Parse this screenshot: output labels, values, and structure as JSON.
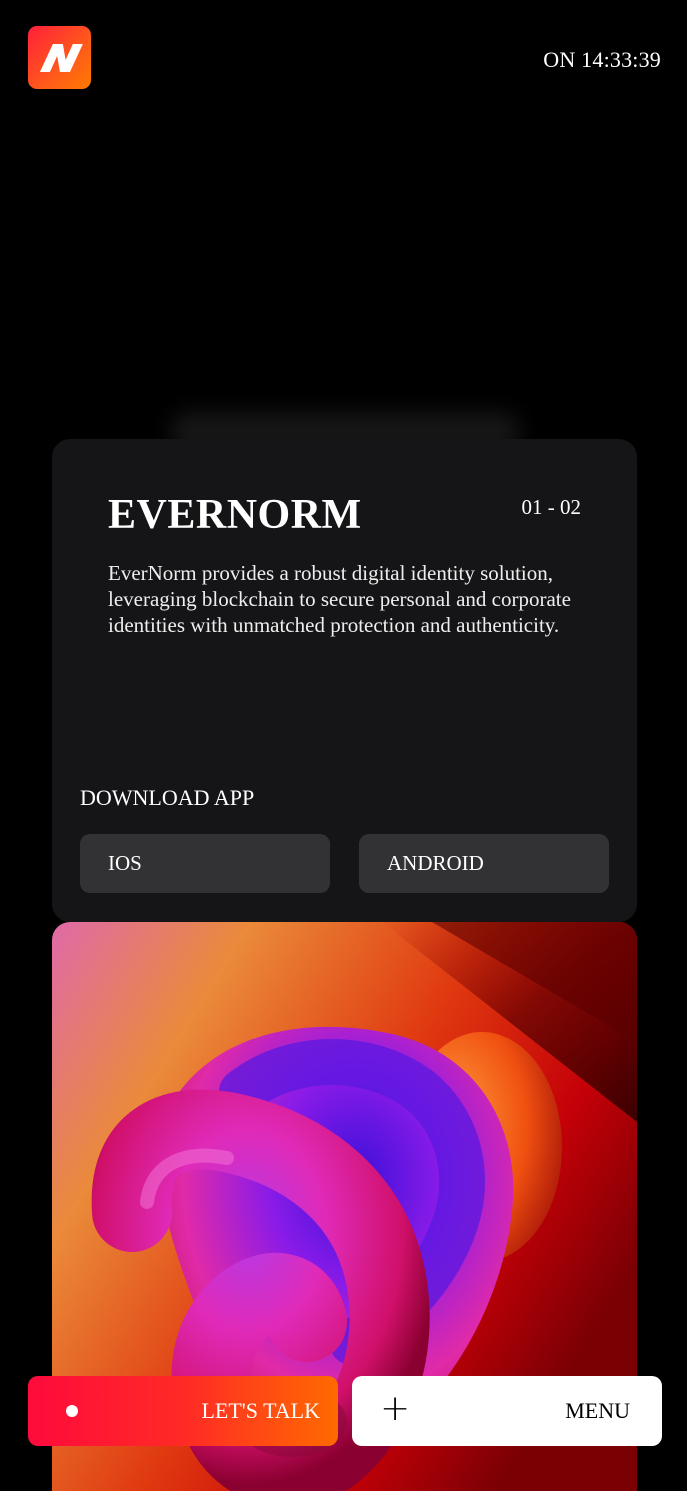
{
  "header": {
    "logo_icon": "n-logo-icon",
    "clock_text": "ON 14:33:39"
  },
  "project": {
    "title": "EVERNORM",
    "counter": "01 - 02",
    "description": "EverNorm provides a robust digital identity solution, leveraging blockchain to secure personal and corporate identities with unmatched protection and authenticity.",
    "download_label": "DOWNLOAD APP",
    "ios_label": "IOS",
    "android_label": "ANDROID"
  },
  "footer": {
    "talk_label": "LET'S TALK",
    "menu_label": "MENU",
    "menu_icon": "plus-icon"
  },
  "colors": {
    "accent_start": "#ff0a3c",
    "accent_end": "#ff6a00",
    "card_bg": "#151517",
    "button_bg": "#323234"
  }
}
